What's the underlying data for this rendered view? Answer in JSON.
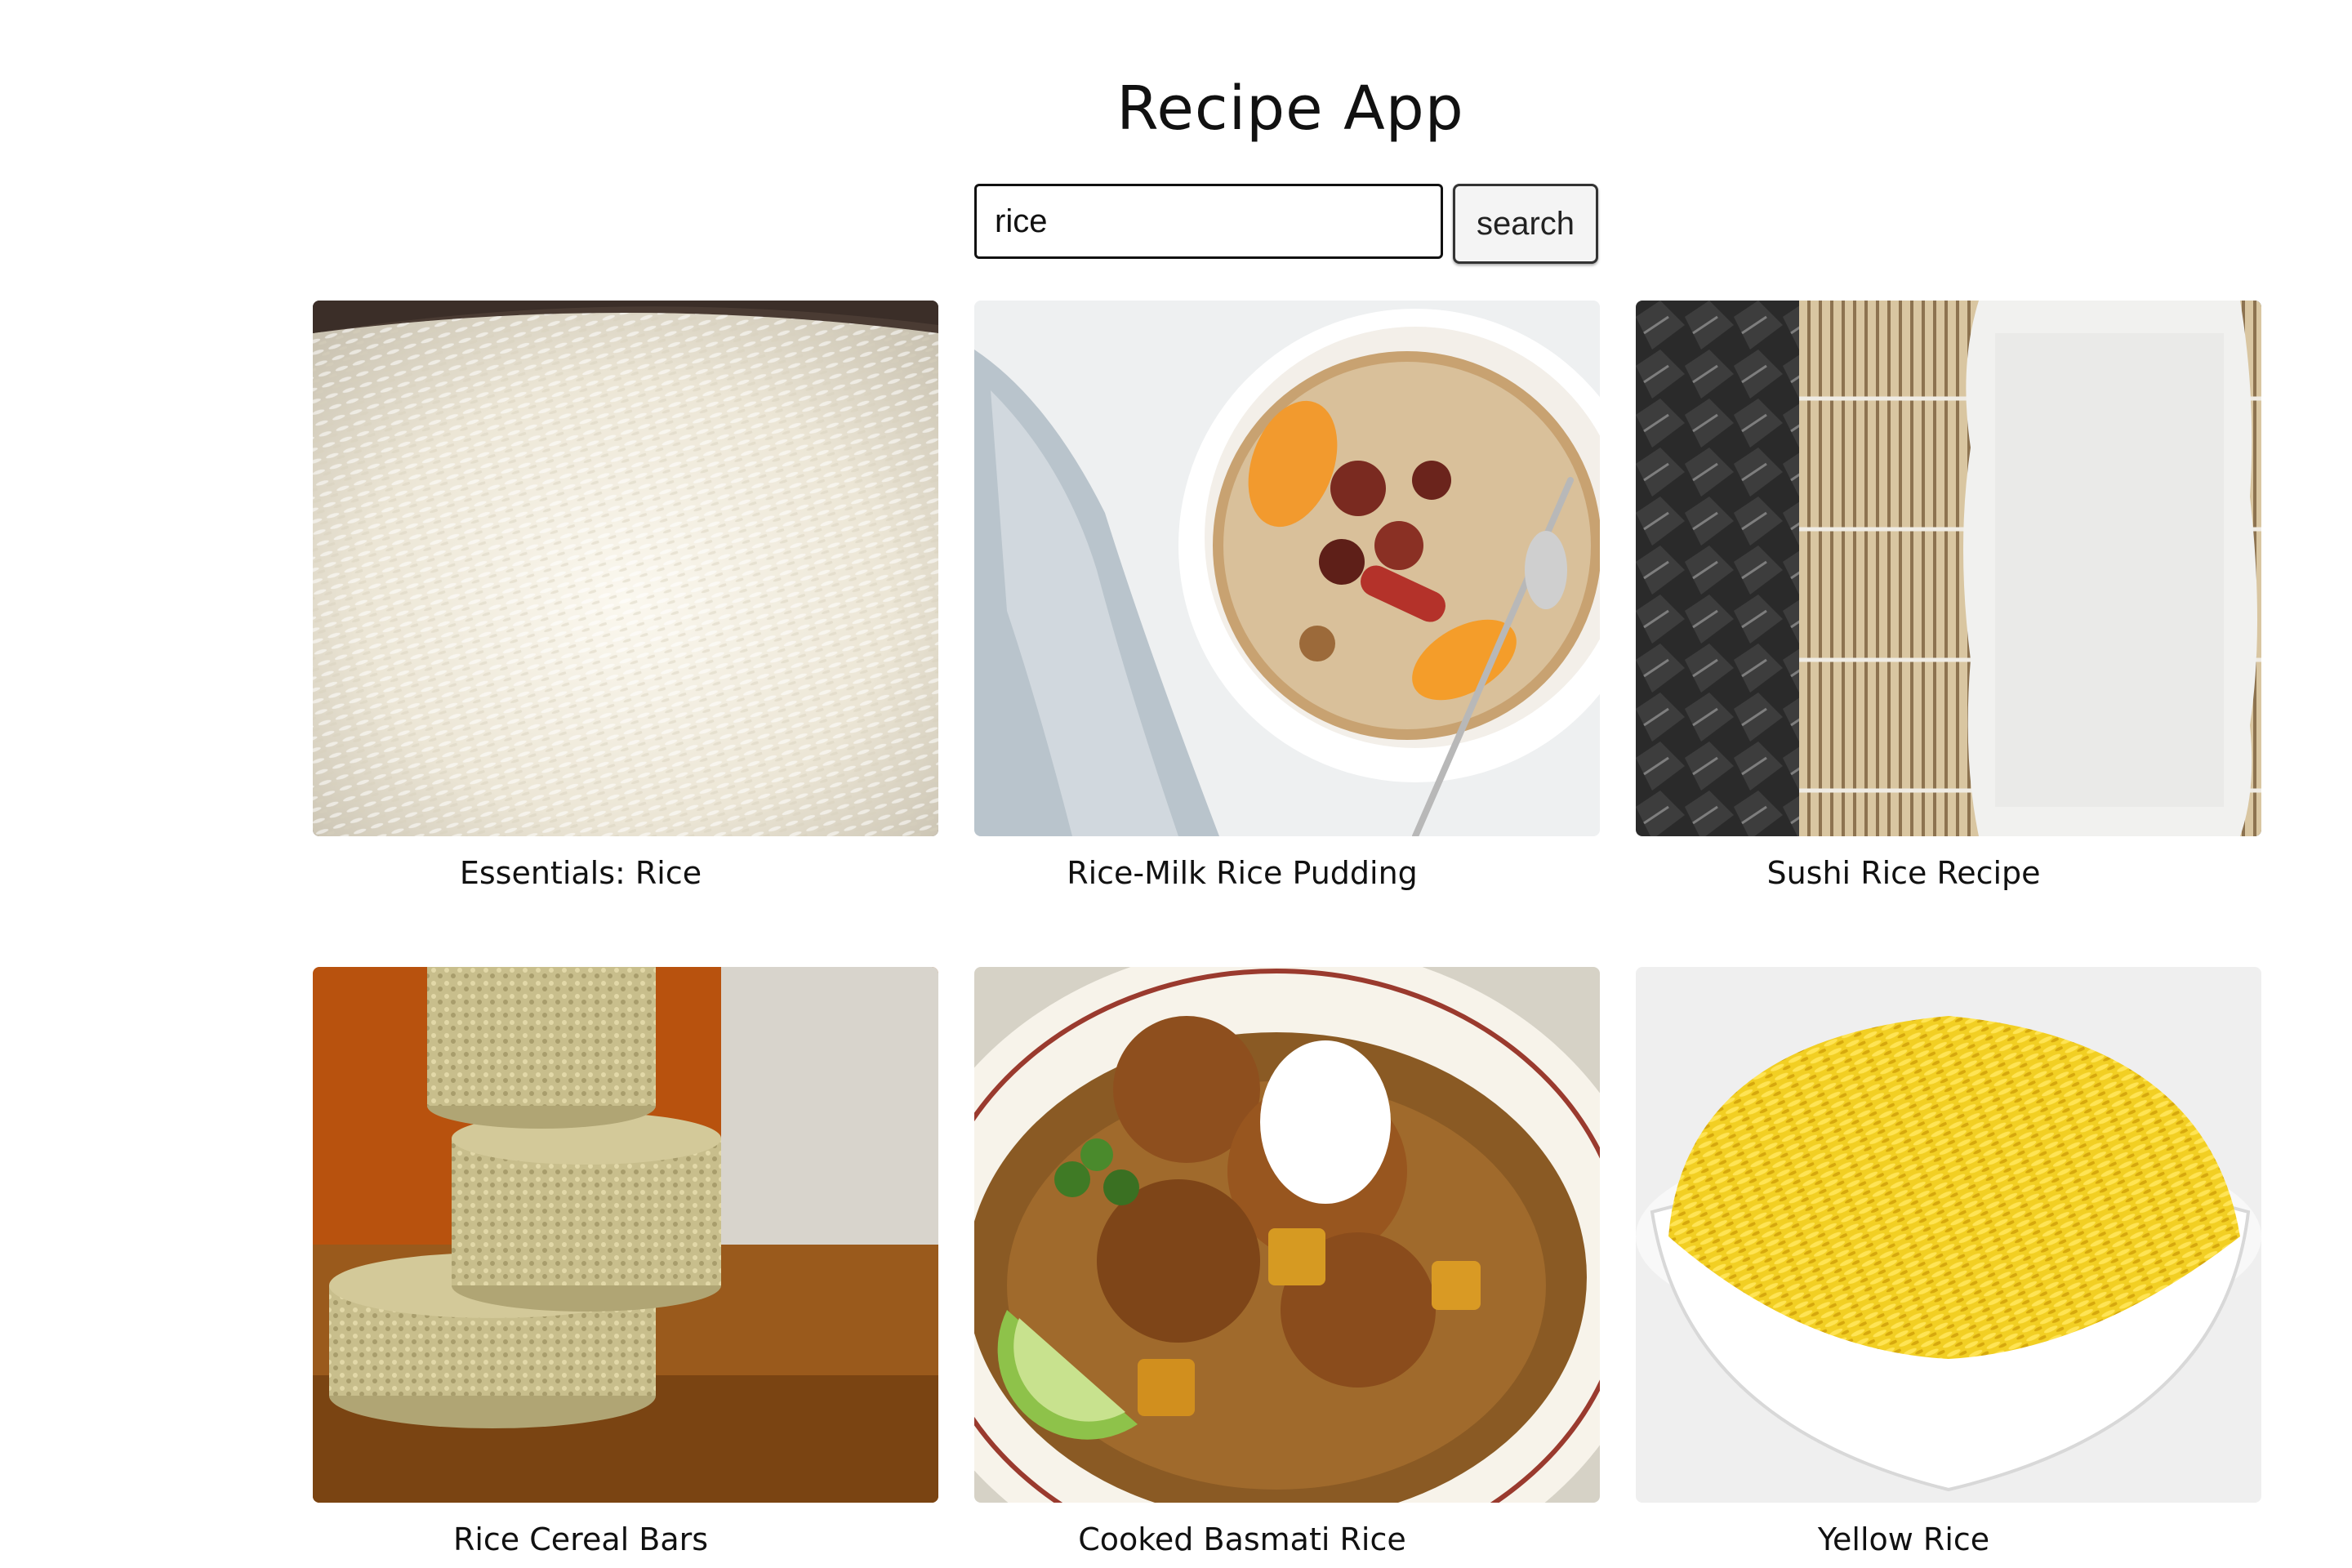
{
  "header": {
    "title": "Recipe App"
  },
  "search": {
    "value": "rice",
    "button_label": "search"
  },
  "recipes": [
    {
      "title": "Essentials: Rice",
      "image": "white-rice-pot"
    },
    {
      "title": "Rice-Milk Rice Pudding",
      "image": "rice-pudding-bowl"
    },
    {
      "title": "Sushi Rice Recipe",
      "image": "sushi-rice-mat"
    },
    {
      "title": "Rice Cereal Bars",
      "image": "rice-cereal-bars-stack"
    },
    {
      "title": "Cooked Basmati Rice",
      "image": "curry-plate"
    },
    {
      "title": "Yellow Rice",
      "image": "yellow-rice-bowl"
    }
  ]
}
